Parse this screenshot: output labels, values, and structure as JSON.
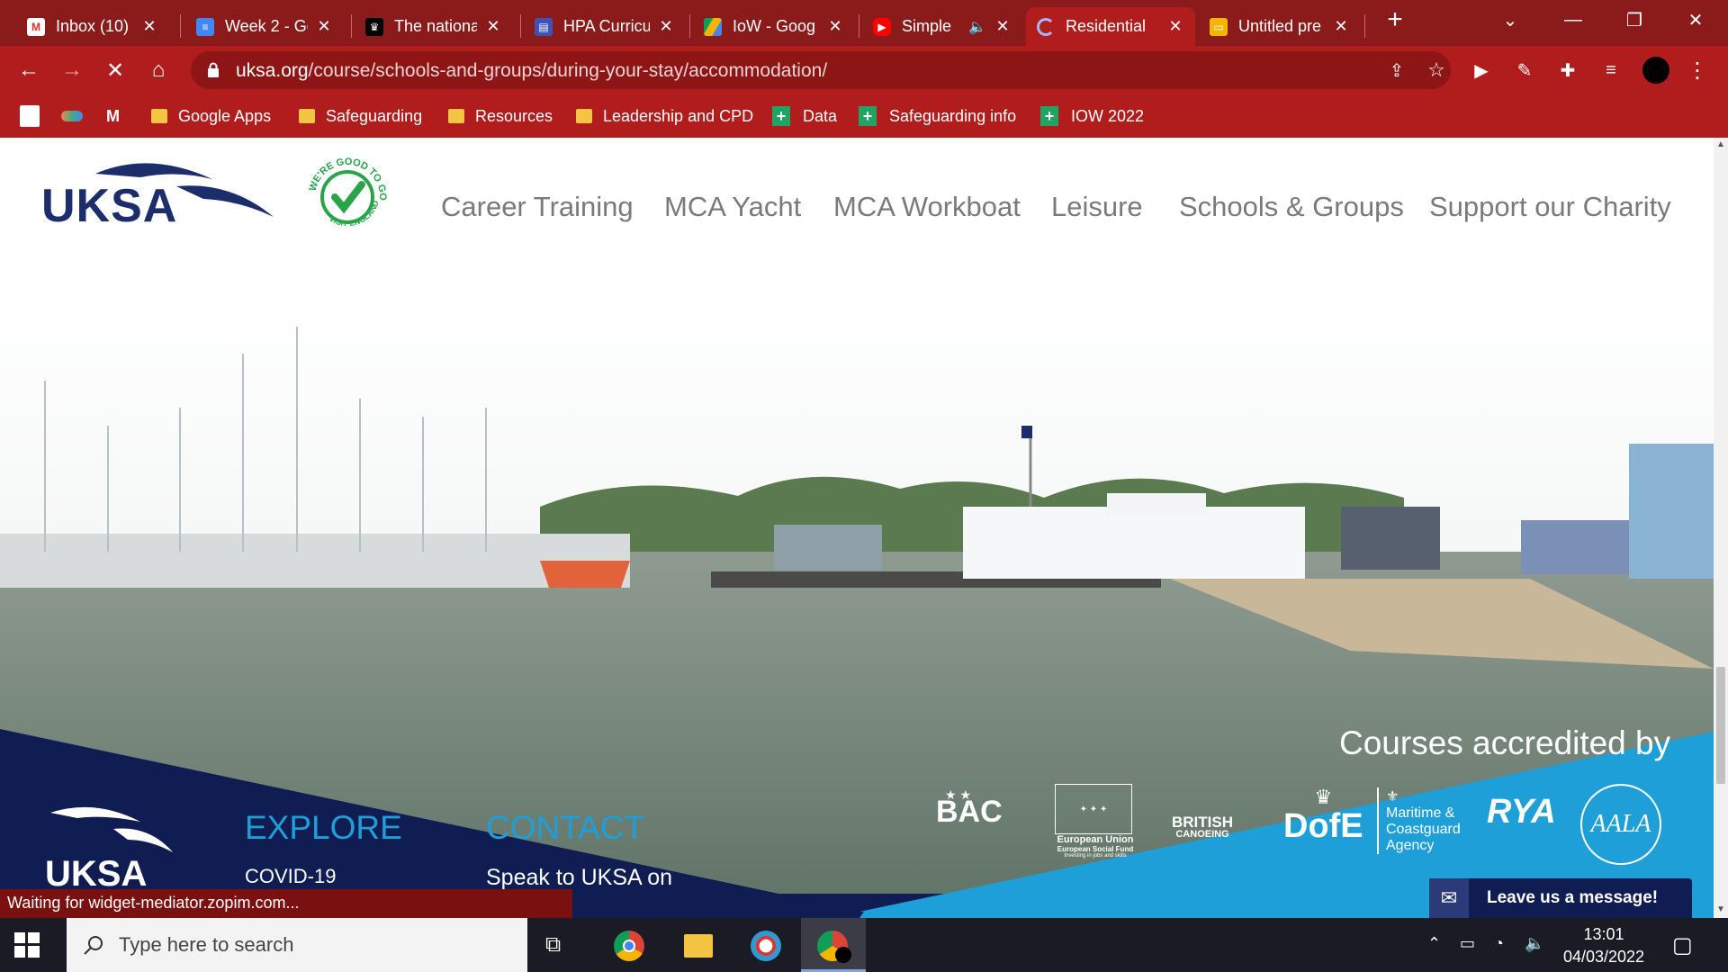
{
  "tabs": [
    {
      "label": "Inbox (10) -",
      "icon": "gmail-icon",
      "active": false
    },
    {
      "label": "Week 2 - Go",
      "icon": "docs-icon",
      "active": false
    },
    {
      "label": "The nationa",
      "icon": "crown-icon",
      "active": false
    },
    {
      "label": "HPA Curricu",
      "icon": "forms-icon",
      "active": false
    },
    {
      "label": "IoW - Goog",
      "icon": "drive-icon",
      "active": false
    },
    {
      "label": "Simple",
      "icon": "youtube-icon",
      "active": false
    },
    {
      "label": "Residential",
      "icon": "loading-icon",
      "active": true
    },
    {
      "label": "Untitled pre",
      "icon": "slides-icon",
      "active": false
    }
  ],
  "toolbar": {
    "url_domain": "uksa.org",
    "url_path": "/course/schools-and-groups/during-your-stay/accommodation/"
  },
  "bookmarks": [
    {
      "label": "Google Apps",
      "type": "folder"
    },
    {
      "label": "Safeguarding",
      "type": "folder"
    },
    {
      "label": "Resources",
      "type": "folder"
    },
    {
      "label": "Leadership and CPD",
      "type": "folder"
    },
    {
      "label": "Data",
      "type": "sheet"
    },
    {
      "label": "Safeguarding info",
      "type": "sheet"
    },
    {
      "label": "IOW 2022",
      "type": "sheet"
    }
  ],
  "site": {
    "logo_text": "UKSA",
    "badge_top": "WE'RE GOOD TO GO",
    "badge_bottom": "VISIT ENGLAND",
    "nav": [
      "Career Training",
      "MCA Yacht",
      "MCA Workboat",
      "Leisure",
      "Schools & Groups",
      "Support our Charity"
    ],
    "accredited_heading": "Courses accredited by",
    "accreditations": {
      "bac": "BAC",
      "eu_line1": "European Union",
      "eu_line2": "European Social Fund",
      "eu_line3": "Investing in jobs and skills",
      "canoeing_line1": "BRITISH",
      "canoeing_line2": "CANOEING",
      "dofe": "DofE",
      "mca_line1": "Maritime &",
      "mca_line2": "Coastguard",
      "mca_line3": "Agency",
      "rya": "RYA",
      "aala": "AALA"
    },
    "footer_logo_text": "UKSA",
    "explore_heading": "EXPLORE",
    "explore_first": "COVID-19",
    "contact_heading": "CONTACT",
    "contact_first": "Speak to UKSA on",
    "chat_label": "Leave us a message!"
  },
  "status_text": "Waiting for widget-mediator.zopim.com...",
  "taskbar": {
    "search_placeholder": "Type here to search",
    "time": "13:01",
    "date": "04/03/2022"
  },
  "colors": {
    "chrome_dark": "#8b1a1a",
    "chrome": "#b11c1c",
    "navy": "#0f1d52",
    "sky": "#1e9fd8"
  }
}
